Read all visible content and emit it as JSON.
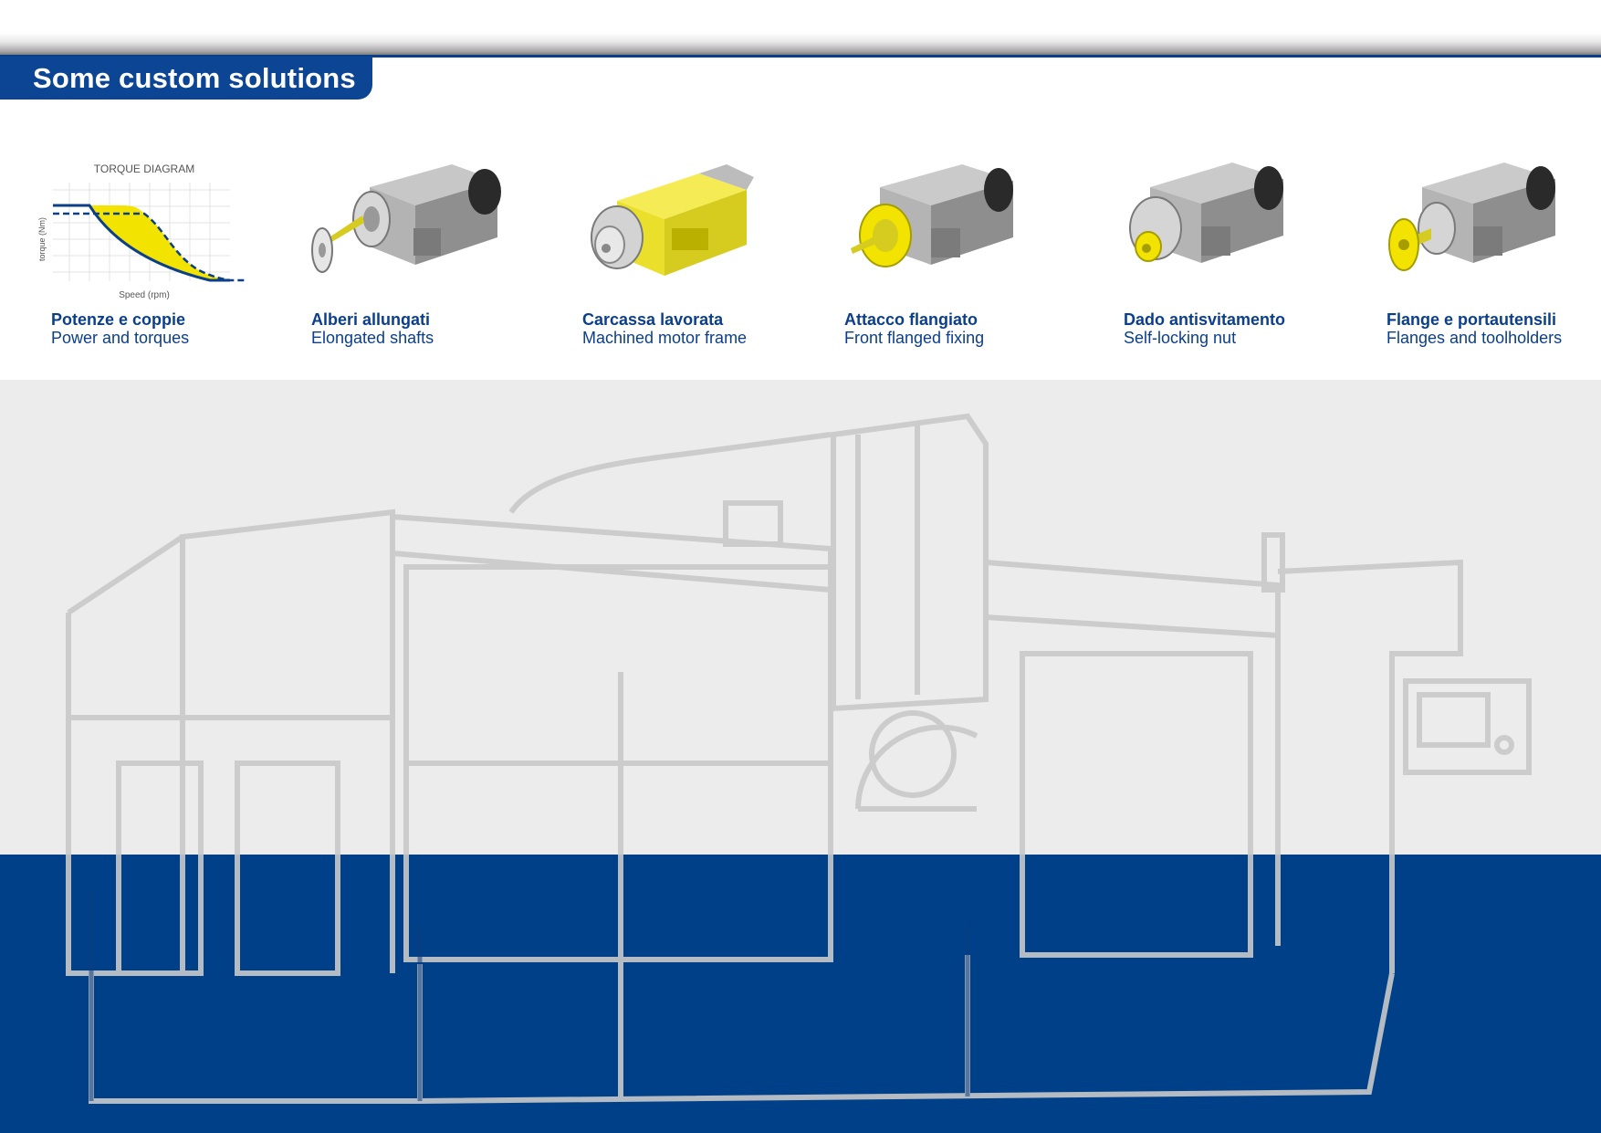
{
  "section": {
    "title": "Some custom solutions"
  },
  "torque_diagram": {
    "title": "TORQUE DIAGRAM",
    "ylabel": "torque (Nm)",
    "xlabel": "Speed (rpm)"
  },
  "products": [
    {
      "title": "Potenze e coppie",
      "subtitle": "Power and torques"
    },
    {
      "title": "Alberi allungati",
      "subtitle": "Elongated shafts"
    },
    {
      "title": "Carcassa lavorata",
      "subtitle": "Machined motor frame"
    },
    {
      "title": "Attacco flangiato",
      "subtitle": "Front flanged fixing"
    },
    {
      "title": "Dado antisvitamento",
      "subtitle": "Self-locking nut"
    },
    {
      "title": "Flange e portautensili",
      "subtitle": "Flanges and toolholders"
    }
  ],
  "colors": {
    "brand_blue": "#0b4593",
    "deep_blue": "#004088",
    "highlight_yellow": "#f2e400",
    "motor_grey": "#9a9a9a",
    "watermark_grey": "#c9c9c9"
  }
}
